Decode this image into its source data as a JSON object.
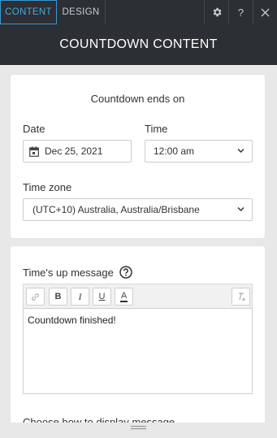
{
  "tabs": {
    "content": "CONTENT",
    "design": "DESIGN"
  },
  "topbar": {
    "help_label": "?",
    "close_label": "✕"
  },
  "header": {
    "title": "COUNTDOWN CONTENT"
  },
  "countdown": {
    "title": "Countdown ends on",
    "date_label": "Date",
    "date_value": "Dec 25, 2021",
    "time_label": "Time",
    "time_value": "12:00 am",
    "timezone_label": "Time zone",
    "timezone_value": "(UTC+10) Australia, Australia/Brisbane"
  },
  "message": {
    "label": "Time's up message",
    "toolbar": {
      "bold": "B",
      "italic": "I",
      "underline": "U",
      "color": "A"
    },
    "editor_text": "Countdown finished!",
    "next_label": "Choose how to display message"
  },
  "colors": {
    "topbar": "#2c2f33",
    "accent": "#3b97d3",
    "panel_bg": "#e8e8e8"
  }
}
